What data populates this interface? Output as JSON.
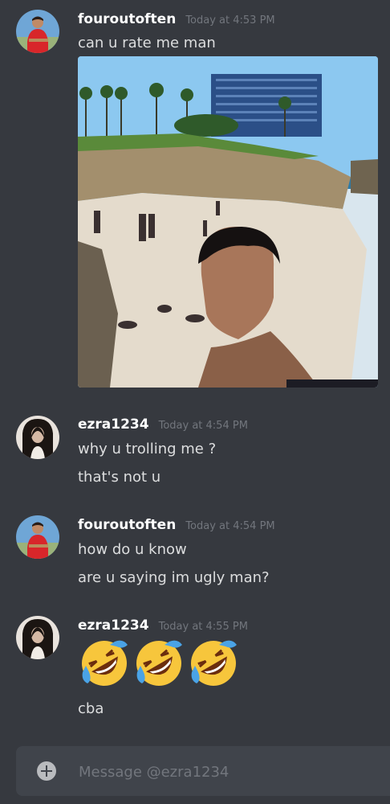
{
  "messages": [
    {
      "username": "fouroutoften",
      "timestamp": "Today at 4:53 PM",
      "lines": [
        "can u rate me man"
      ]
    },
    {
      "username": "ezra1234",
      "timestamp": "Today at 4:54 PM",
      "lines": [
        "why u trolling me ?",
        "that's not u"
      ]
    },
    {
      "username": "fouroutoften",
      "timestamp": "Today at 4:54 PM",
      "lines": [
        "how do u know",
        "are u saying im ugly man?"
      ]
    },
    {
      "username": "ezra1234",
      "timestamp": "Today at 4:55 PM",
      "emoji": [
        "rolling-on-floor-laughing-emoji",
        "rolling-on-floor-laughing-emoji",
        "rolling-on-floor-laughing-emoji"
      ],
      "lines": [
        "cba"
      ]
    }
  ],
  "composer": {
    "placeholder": "Message @ezra1234"
  },
  "colors": {
    "background": "#36393f",
    "composer_bg": "#40444b",
    "username": "#ffffff",
    "timestamp": "#72767d",
    "text": "#dcddde"
  }
}
